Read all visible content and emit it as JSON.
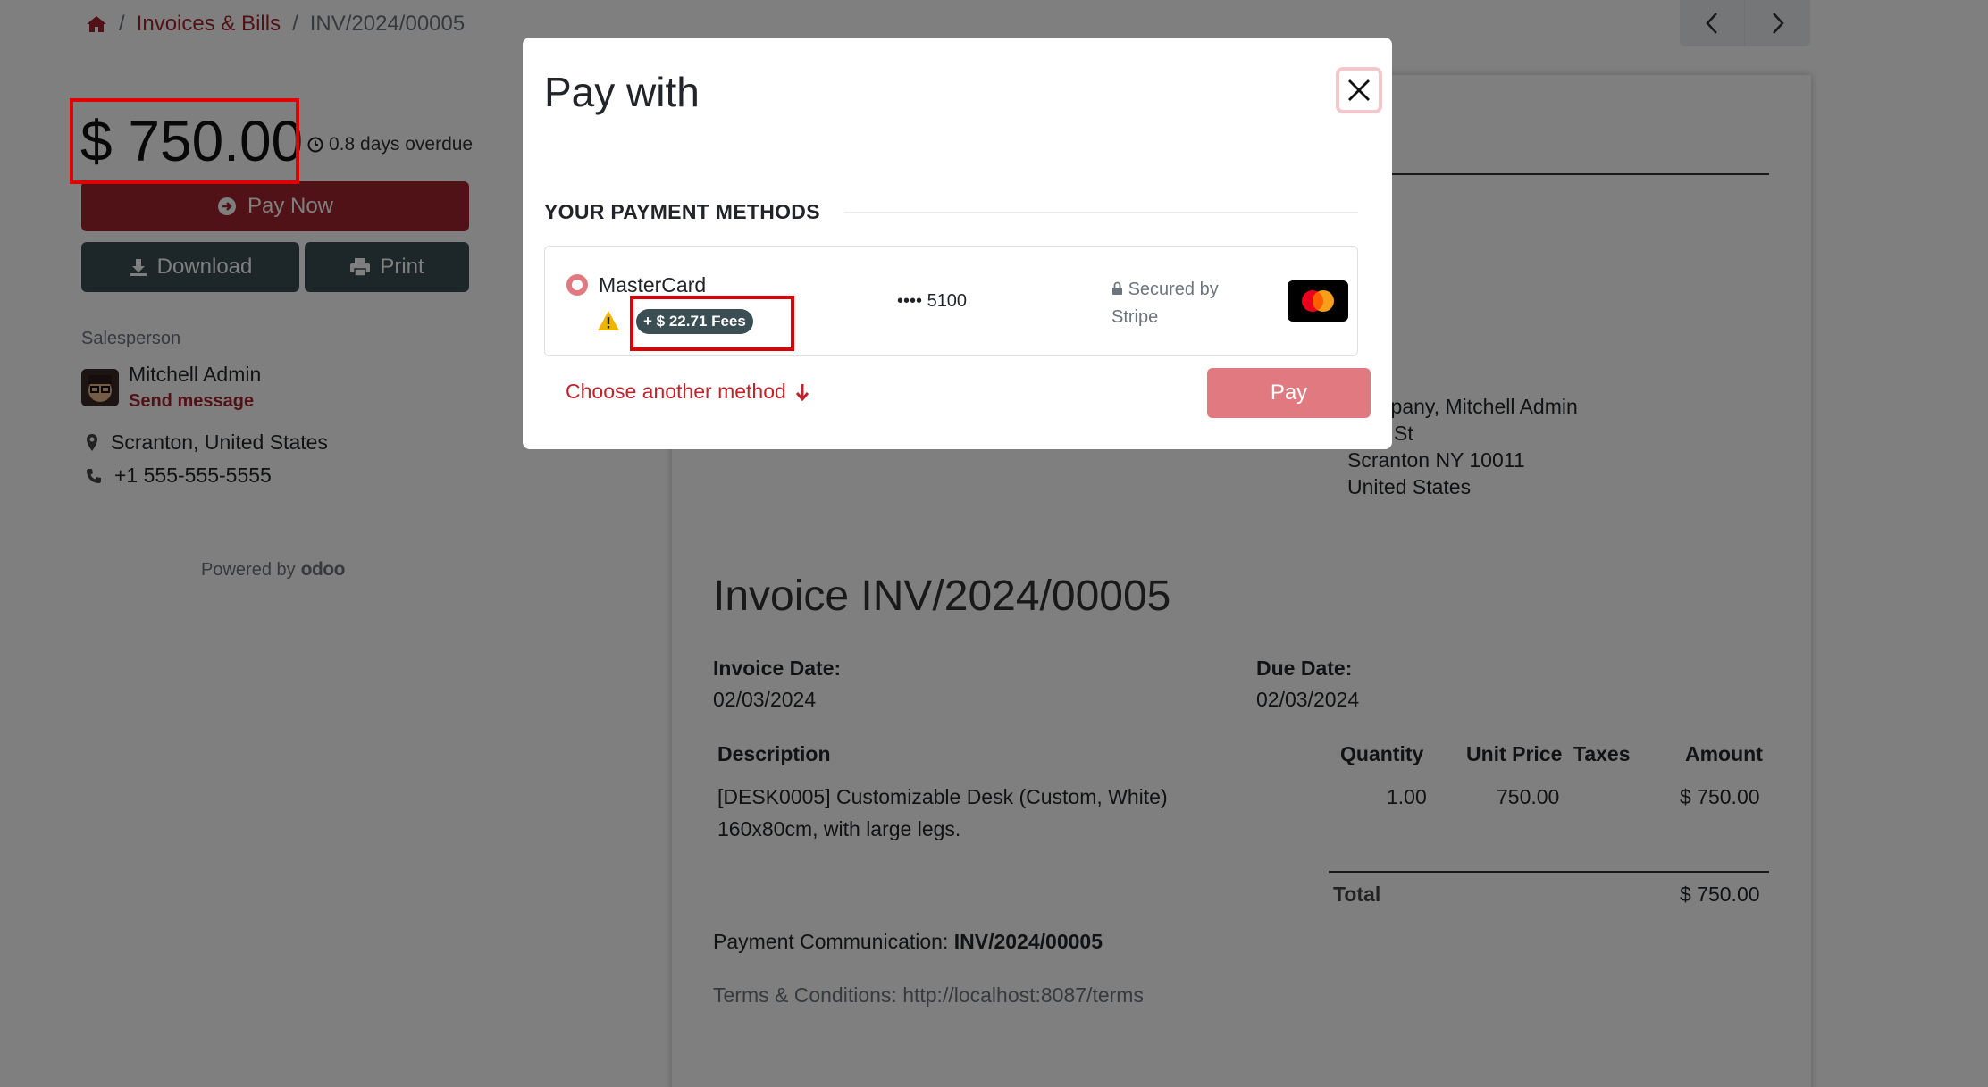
{
  "breadcrumb": {
    "home_icon": "home-icon",
    "items": [
      "Invoices & Bills",
      "INV/2024/00005"
    ],
    "separator": "/"
  },
  "pager": {
    "prev_icon": "chevron-left-icon",
    "next_icon": "chevron-right-icon"
  },
  "sidebar": {
    "amount": "$ 750.00",
    "overdue": "0.8 days overdue",
    "pay_now": "Pay Now",
    "download": "Download",
    "print": "Print",
    "salesperson_label": "Salesperson",
    "salesperson_name": "Mitchell Admin",
    "send_message": "Send message",
    "location": "Scranton, United States",
    "phone": "+1 555-555-5555",
    "powered_by": "Powered by",
    "powered_logo": "odoo"
  },
  "invoice": {
    "address": [
      "Company, Mitchell Admin",
      "Vine St",
      "Scranton NY 10011",
      "United States"
    ],
    "title": "Invoice INV/2024/00005",
    "invoice_date_label": "Invoice Date:",
    "invoice_date": "02/03/2024",
    "due_date_label": "Due Date:",
    "due_date": "02/03/2024",
    "columns": {
      "description": "Description",
      "quantity": "Quantity",
      "unit_price": "Unit Price",
      "taxes": "Taxes",
      "amount": "Amount"
    },
    "line": {
      "description_1": "[DESK0005] Customizable Desk (Custom, White)",
      "description_2": "160x80cm, with large legs.",
      "quantity": "1.00",
      "unit_price": "750.00",
      "amount": "$ 750.00"
    },
    "total_label": "Total",
    "total": "$ 750.00",
    "payment_comm_label": "Payment Communication:",
    "payment_comm": "INV/2024/00005",
    "terms": "Terms & Conditions: http://localhost:8087/terms"
  },
  "modal": {
    "title": "Pay with",
    "close_icon": "close-icon",
    "section_heading": "YOUR PAYMENT METHODS",
    "method_name": "MasterCard",
    "fee": "+ $ 22.71 Fees",
    "card_number": "•••• 5100",
    "secured_line1": "Secured by",
    "secured_line2": "Stripe",
    "choose_another": "Choose another method",
    "pay": "Pay"
  },
  "colors": {
    "brand": "#a1242c",
    "pay_button": "#e07a80",
    "dark_button": "#3b4e54",
    "highlight": "#e00000",
    "backdrop": "rgba(0,0,0,0.5)"
  }
}
